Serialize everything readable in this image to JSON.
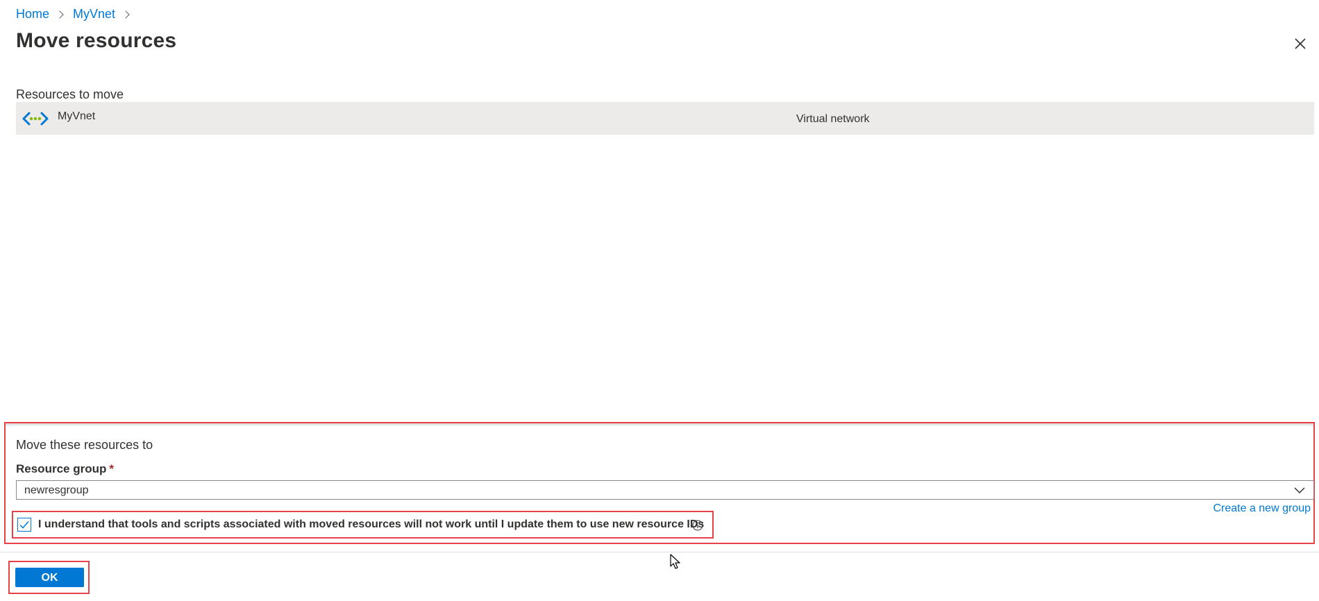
{
  "breadcrumb": {
    "items": [
      {
        "label": "Home"
      },
      {
        "label": "MyVnet"
      }
    ]
  },
  "page": {
    "title": "Move resources"
  },
  "resources": {
    "heading": "Resources to move",
    "items": [
      {
        "name": "MyVnet",
        "type": "Virtual network",
        "icon": "virtual-network-icon"
      }
    ]
  },
  "move_to": {
    "heading": "Move these resources to",
    "resource_group_label": "Resource group",
    "required_marker": "*",
    "resource_group_value": "newresgroup",
    "create_new_link": "Create a new group",
    "acknowledgement": "I understand that tools and scripts associated with moved resources will not work until I update them to use new resource IDs",
    "acknowledged": true
  },
  "footer": {
    "ok_label": "OK"
  },
  "colors": {
    "accent": "#0078d4",
    "highlight_border": "#e8414a",
    "row_background": "#edebe9"
  }
}
